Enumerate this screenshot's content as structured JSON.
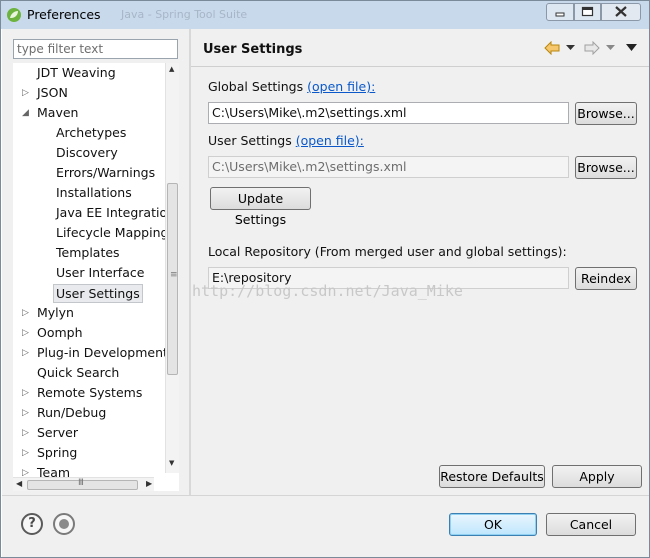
{
  "window": {
    "title": "Preferences",
    "ghost_title": "Java - Spring Tool Suite"
  },
  "filter": {
    "placeholder": "type filter text",
    "value": ""
  },
  "tree": {
    "items": [
      {
        "label": "JDT Weaving",
        "arrow": ""
      },
      {
        "label": "JSON",
        "arrow": "▷"
      },
      {
        "label": "Maven",
        "arrow": "◢"
      },
      {
        "label": "Archetypes",
        "arrow": ""
      },
      {
        "label": "Discovery",
        "arrow": ""
      },
      {
        "label": "Errors/Warnings",
        "arrow": ""
      },
      {
        "label": "Installations",
        "arrow": ""
      },
      {
        "label": "Java EE Integration",
        "arrow": ""
      },
      {
        "label": "Lifecycle Mapping",
        "arrow": ""
      },
      {
        "label": "Templates",
        "arrow": ""
      },
      {
        "label": "User Interface",
        "arrow": ""
      },
      {
        "label": "User Settings",
        "arrow": "",
        "selected": true
      },
      {
        "label": "Mylyn",
        "arrow": "▷"
      },
      {
        "label": "Oomph",
        "arrow": "▷"
      },
      {
        "label": "Plug-in Development",
        "arrow": "▷"
      },
      {
        "label": "Quick Search",
        "arrow": ""
      },
      {
        "label": "Remote Systems",
        "arrow": "▷"
      },
      {
        "label": "Run/Debug",
        "arrow": "▷"
      },
      {
        "label": "Server",
        "arrow": "▷"
      },
      {
        "label": "Spring",
        "arrow": "▷"
      },
      {
        "label": "Team",
        "arrow": "▷"
      }
    ]
  },
  "page": {
    "title": "User Settings",
    "global_label": "Global Settings",
    "global_open": "(open file):",
    "global_path": "C:\\Users\\Mike\\.m2\\settings.xml",
    "user_label": "User Settings",
    "user_open": "(open file):",
    "user_path": "C:\\Users\\Mike\\.m2\\settings.xml",
    "browse1": "Browse...",
    "browse2": "Browse...",
    "update": "Update Settings",
    "local_label": "Local Repository (From merged user and global settings):",
    "local_path": "E:\\repository",
    "reindex": "Reindex",
    "restore": "Restore Defaults",
    "apply": "Apply"
  },
  "watermark": "http://blog.csdn.net/Java_Mike",
  "footer": {
    "ok": "OK",
    "cancel": "Cancel"
  },
  "colors": {
    "link": "#0a58ca",
    "accent": "#3c7fb1"
  }
}
